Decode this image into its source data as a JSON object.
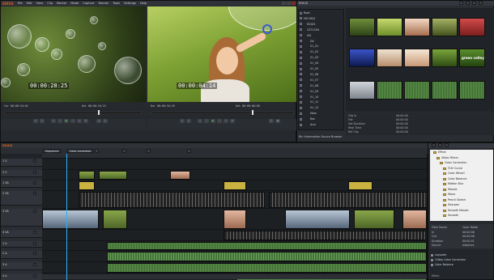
{
  "app": {
    "logo": "EDIUS"
  },
  "menu": [
    "File",
    "Edit",
    "View",
    "Clip",
    "Marker",
    "Mode",
    "Capture",
    "Render",
    "Tools",
    "Settings",
    "Help"
  ],
  "player": {
    "recorder_tc": "00:00:28:25",
    "program_tc": "00:00:04:14",
    "rec_in": "Cur 00:00:34:02",
    "rec_out": "Out 00:00:34:15",
    "prg_in": "Dur 00:00:34:29",
    "prg_out": "Out 00:00:00:00"
  },
  "bin": {
    "title": "EDIUS",
    "tree": [
      "Root",
      "HD NS/S",
      "EDIUS",
      "23T1394",
      "HD",
      "DV",
      "01_01",
      "01_02",
      "01_03",
      "01_04",
      "01_05",
      "01_06",
      "01_07",
      "01_08",
      "01_09",
      "01_10",
      "01_11",
      "01_12",
      "Mow",
      "Rec",
      "Aud"
    ],
    "thumb_caption": "green valley",
    "props": [
      "Clip In",
      "File",
      "Set Duration",
      "Real Time",
      "Ref Clip"
    ],
    "prop_values": [
      "00:00:00",
      "00:00:00",
      "00:00:00",
      "00:00:00",
      "00:00:00"
    ],
    "footer": "Bin Information  Source Browser"
  },
  "timeline": {
    "sequence": "EDIUS",
    "tabs": [
      "Sequence",
      "Color correction"
    ],
    "tracks": [
      "1 V",
      "2 V",
      "1 VA",
      "2 VA",
      "3 VA",
      "4 VA",
      "1 A",
      "2 A",
      "3 A",
      "4 A"
    ]
  },
  "effects": {
    "tree": [
      "Effect",
      "Video Filters",
      "Color Correction",
      "YUV Curve",
      "Color Wheel",
      "Color Balance",
      "Motion Blur",
      "Mosaic",
      "Mono",
      "Pencil Sketch",
      "Sharpen",
      "Smooth Mosaic",
      "Smooth"
    ],
    "info": [
      [
        "Filter Name",
        "Color Matte"
      ],
      [
        "In",
        "00:00:06"
      ],
      [
        "Out",
        "00:00:06"
      ],
      [
        "Duration",
        "00:00:01"
      ],
      [
        "Source",
        "Adaptive"
      ]
    ],
    "list": [
      "Layouter",
      "3-Way Color Correction",
      "Color Balance"
    ],
    "footer": "Effect"
  }
}
